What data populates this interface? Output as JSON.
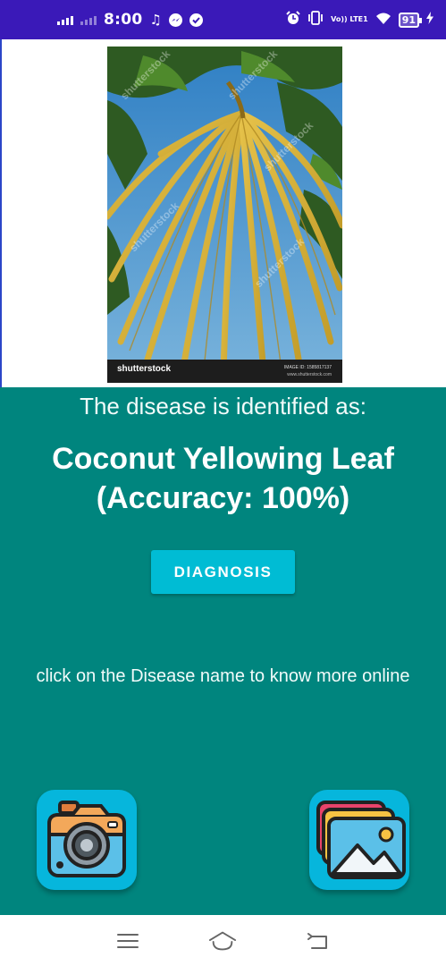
{
  "status_bar": {
    "time": "8:00",
    "volte_label": "Vo)) LTE1",
    "battery_level": "91",
    "icons": [
      "signal-icon",
      "music-note-icon",
      "messenger-icon",
      "check-circle-icon",
      "alarm-icon",
      "vibrate-icon",
      "wifi-icon",
      "battery-icon",
      "charging-icon"
    ]
  },
  "image": {
    "description_icon": "coconut-palm-leaf-photo",
    "watermark": "shutterstock",
    "footer_text": "shutterstock",
    "image_id_text": "IMAGE ID: 1585817137",
    "site_text": "www.shutterstock.com"
  },
  "result": {
    "heading": "The disease is identified as:",
    "disease_line1": "Coconut Yellowing Leaf",
    "disease_line2": "(Accuracy: 100%)",
    "diagnosis_button": "DIAGNOSIS",
    "hint": "click on the Disease name to know more online"
  },
  "actions": {
    "camera_icon": "camera-icon",
    "gallery_icon": "gallery-icon"
  },
  "nav": {
    "icons": [
      "menu-icon",
      "home-icon",
      "back-icon"
    ]
  },
  "colors": {
    "status_bar": "#3a19b8",
    "panel": "#00857e",
    "button": "#00bcd4",
    "tile": "#06b6dc"
  }
}
